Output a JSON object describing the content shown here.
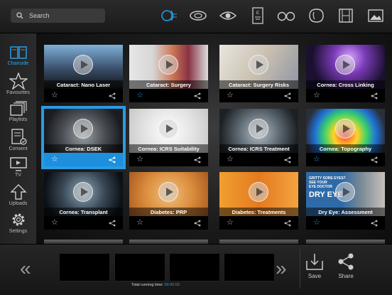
{
  "search": {
    "placeholder": "Search"
  },
  "top_icons": [
    "cornea-icon",
    "lens-icon",
    "eye-icon",
    "eye-chart-icon",
    "glasses-icon",
    "retina-icon",
    "film-icon",
    "image-icon"
  ],
  "sidebar": {
    "items": [
      {
        "label": "Chairside",
        "icon": "book-icon",
        "active": true
      },
      {
        "label": "Favourites",
        "icon": "star-icon",
        "active": false
      },
      {
        "label": "Playlists",
        "icon": "playlist-icon",
        "active": false
      },
      {
        "label": "Consent",
        "icon": "consent-icon",
        "active": false
      },
      {
        "label": "TV",
        "icon": "tv-icon",
        "active": false
      },
      {
        "label": "Uploads",
        "icon": "upload-icon",
        "active": false
      },
      {
        "label": "Settings",
        "icon": "gear-icon",
        "active": false
      }
    ]
  },
  "videos": [
    {
      "title": "Cataract: Nano Laser",
      "favourite": false
    },
    {
      "title": "Cataract: Surgery",
      "favourite": true
    },
    {
      "title": "Cataract: Surgery Risks",
      "favourite": false
    },
    {
      "title": "Cornea: Cross Linking",
      "favourite": false
    },
    {
      "title": "Cornea: DSEK",
      "favourite": false
    },
    {
      "title": "Cornea: ICRS Suitability",
      "favourite": false
    },
    {
      "title": "Cornea: ICRS Treatment",
      "favourite": false
    },
    {
      "title": "Cornea: Topography",
      "favourite": true
    },
    {
      "title": "Cornea: Transplant",
      "favourite": false
    },
    {
      "title": "Diabetes: PRP",
      "favourite": false
    },
    {
      "title": "Diabetes: Treatments",
      "favourite": false
    },
    {
      "title": "Dry Eye: Assessment",
      "favourite": true
    }
  ],
  "selected_video": "Cornea: DSEK",
  "dry_eye_thumb": {
    "line1": "GRITTY SORE EYES?",
    "line2": "SEE YOUR",
    "line3": "EYE DOCTOR",
    "big": "DRY EYE"
  },
  "bottom": {
    "runtime_label": "Total running time:",
    "runtime_value": "00:00:00",
    "save_label": "Save",
    "share_label": "Share"
  },
  "colors": {
    "accent": "#2a9be3"
  }
}
